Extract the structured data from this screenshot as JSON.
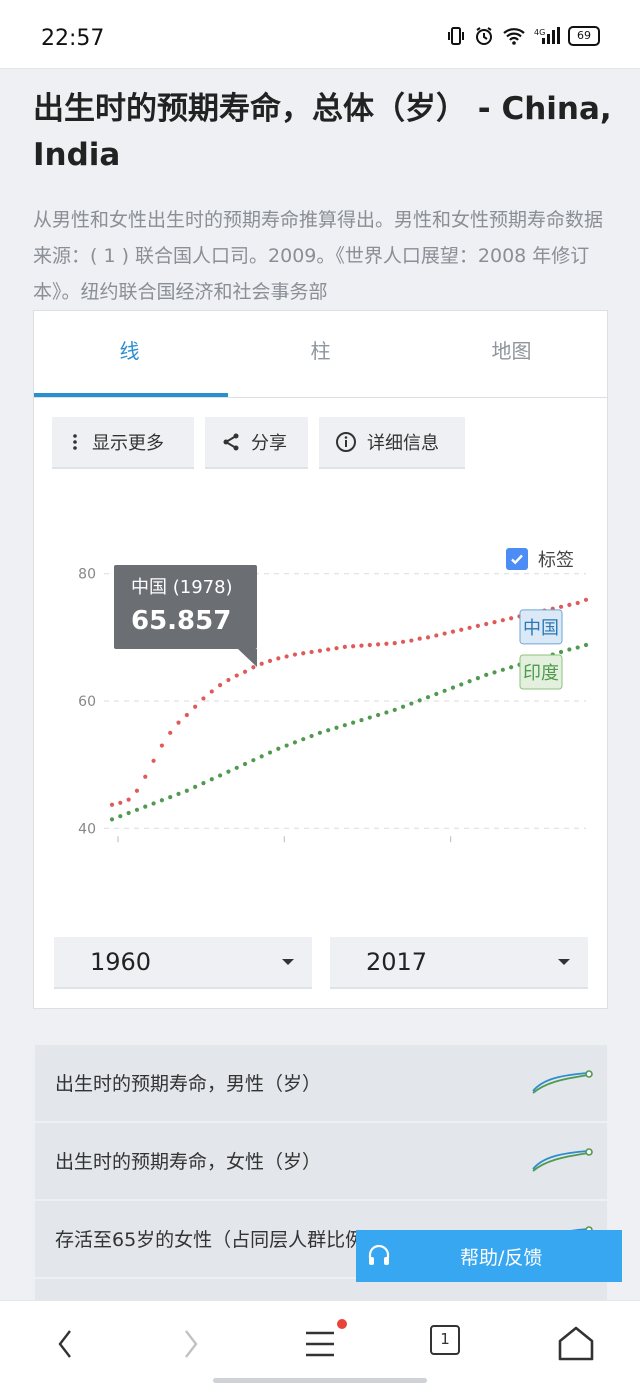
{
  "status_bar": {
    "time": "22:57",
    "battery": "69"
  },
  "page": {
    "title": "出生时的预期寿命，总体（岁） - China, India",
    "description": "从男性和女性出生时的预期寿命推算得出。男性和女性预期寿命数据来源：( 1 ) 联合国人口司。2009。《世界人口展望：2008 年修订本》。纽约联合国经济和社会事务部"
  },
  "tabs": [
    {
      "label": "线",
      "active": true
    },
    {
      "label": "柱",
      "active": false
    },
    {
      "label": "地图",
      "active": false
    }
  ],
  "toolbar": {
    "show_more": "显示更多",
    "share": "分享",
    "details": "详细信息"
  },
  "labels_toggle": {
    "label": "标签",
    "checked": true
  },
  "tooltip": {
    "title": "中国 (1978)",
    "value": "65.857"
  },
  "chart_data": {
    "type": "line",
    "x": [
      1960,
      1961,
      1962,
      1963,
      1964,
      1965,
      1966,
      1967,
      1968,
      1969,
      1970,
      1971,
      1972,
      1973,
      1974,
      1975,
      1976,
      1977,
      1978,
      1979,
      1980,
      1981,
      1982,
      1983,
      1984,
      1985,
      1986,
      1987,
      1988,
      1989,
      1990,
      1991,
      1992,
      1993,
      1994,
      1995,
      1996,
      1997,
      1998,
      1999,
      2000,
      2001,
      2002,
      2003,
      2004,
      2005,
      2006,
      2007,
      2008,
      2009,
      2010,
      2011,
      2012,
      2013,
      2014,
      2015,
      2016,
      2017
    ],
    "series": [
      {
        "name": "中国",
        "color": "#e05a5a",
        "values": [
          43.7,
          44.0,
          44.5,
          45.9,
          48.1,
          50.6,
          53.0,
          55.0,
          56.6,
          57.8,
          59.1,
          60.4,
          61.5,
          62.5,
          63.3,
          64.0,
          64.6,
          65.3,
          65.857,
          66.3,
          66.7,
          67.0,
          67.3,
          67.5,
          67.7,
          67.9,
          68.1,
          68.3,
          68.5,
          68.6,
          68.7,
          68.8,
          68.9,
          69.0,
          69.1,
          69.3,
          69.5,
          69.8,
          70.0,
          70.3,
          70.6,
          70.9,
          71.2,
          71.5,
          71.8,
          72.1,
          72.4,
          72.7,
          73.0,
          73.3,
          73.6,
          73.9,
          74.2,
          74.5,
          74.8,
          75.1,
          75.4,
          75.9
        ]
      },
      {
        "name": "印度",
        "color": "#4f9a4f",
        "values": [
          41.4,
          41.9,
          42.4,
          42.9,
          43.4,
          43.9,
          44.4,
          44.9,
          45.4,
          45.9,
          46.5,
          47.1,
          47.7,
          48.3,
          48.9,
          49.5,
          50.1,
          50.7,
          51.3,
          51.9,
          52.5,
          53.0,
          53.5,
          54.0,
          54.5,
          55.0,
          55.4,
          55.8,
          56.2,
          56.6,
          57.0,
          57.4,
          57.8,
          58.2,
          58.6,
          59.1,
          59.6,
          60.1,
          60.6,
          61.1,
          61.6,
          62.1,
          62.6,
          63.1,
          63.6,
          64.1,
          64.5,
          64.9,
          65.3,
          65.7,
          66.1,
          66.5,
          66.9,
          67.3,
          67.7,
          68.1,
          68.4,
          68.8
        ]
      }
    ],
    "y_ticks": [
      40,
      60,
      80
    ],
    "ylim": [
      38,
      82
    ],
    "grid": true,
    "legend": "inline-right"
  },
  "range": {
    "start": "1960",
    "end": "2017"
  },
  "related": [
    "出生时的预期寿命，男性（岁）",
    "出生时的预期寿命，女性（岁）",
    "存活至65岁的女性（占同层人群比例）"
  ],
  "help_button": "帮助/反馈",
  "nav": {
    "tabs_count": "1"
  },
  "colors": {
    "accent": "#2a8ed1",
    "china": "#e05a5a",
    "india": "#4f9a4f"
  }
}
